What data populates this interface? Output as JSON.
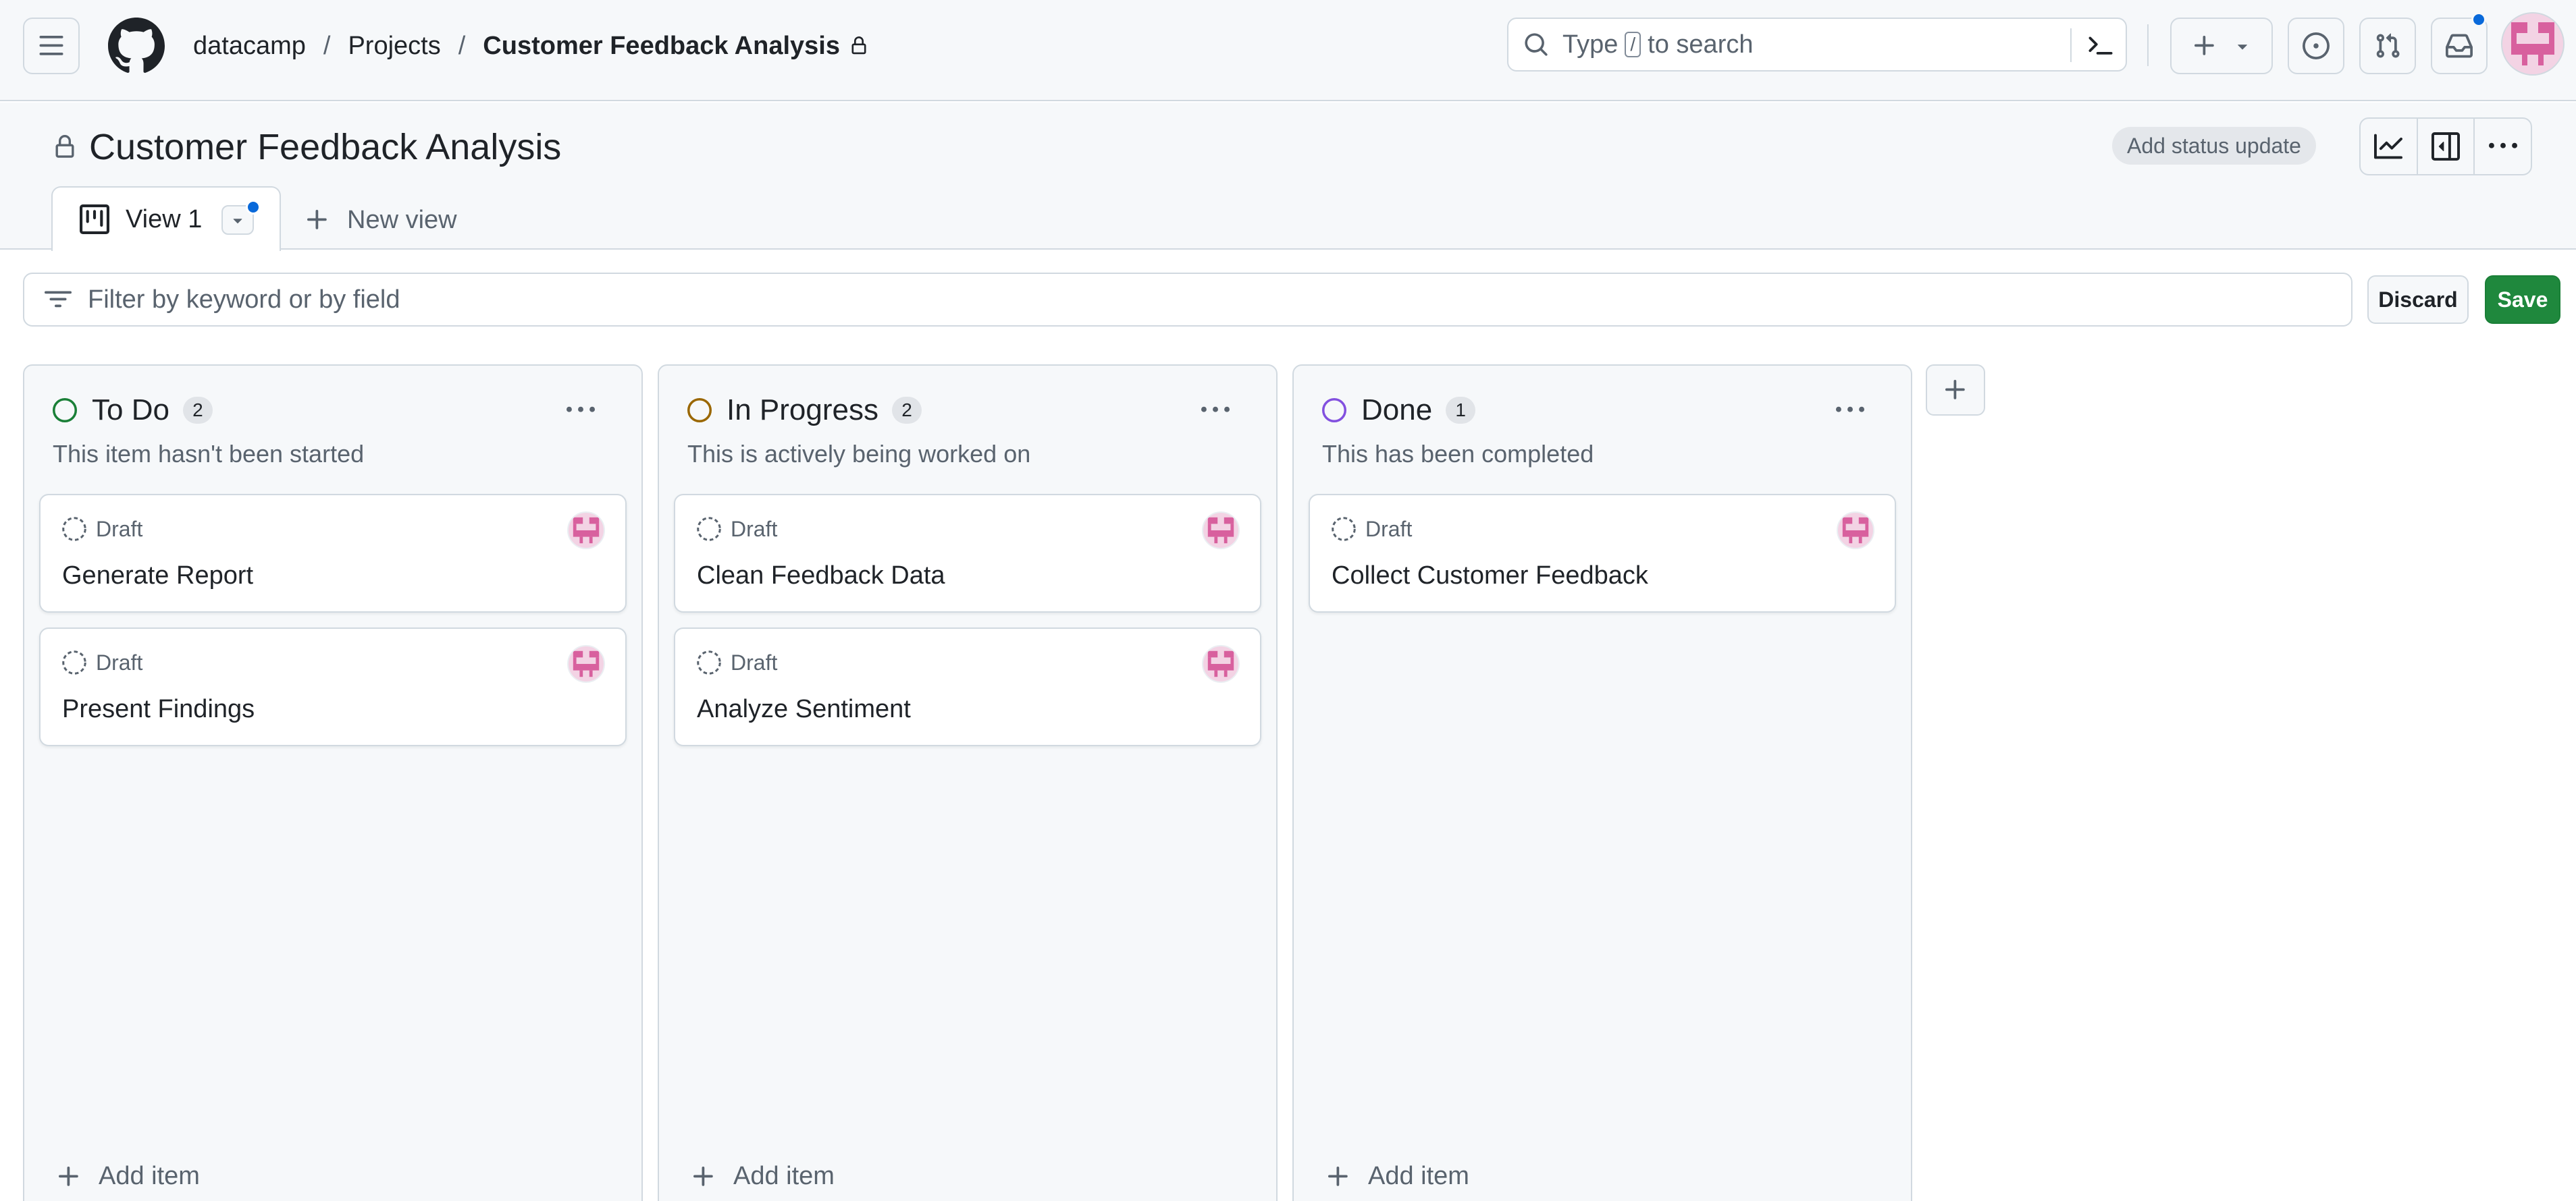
{
  "header": {
    "org": "datacamp",
    "separator": "/",
    "projects_label": "Projects",
    "project_name": "Customer Feedback Analysis",
    "search": {
      "prefix": "Type",
      "key": "/",
      "suffix": "to search"
    }
  },
  "project": {
    "title": "Customer Feedback Analysis",
    "status_button": "Add status update",
    "tabs": [
      {
        "label": "View 1",
        "active": true,
        "icon": "board-icon"
      }
    ],
    "new_view_label": "New view"
  },
  "filter": {
    "placeholder": "Filter by keyword or by field",
    "discard_label": "Discard",
    "save_label": "Save"
  },
  "board": {
    "add_item_label": "Add item",
    "columns": [
      {
        "title": "To Do",
        "count": "2",
        "description": "This item hasn't been started",
        "color": "#1a7f37",
        "cards": [
          {
            "status": "Draft",
            "title": "Generate Report"
          },
          {
            "status": "Draft",
            "title": "Present Findings"
          }
        ]
      },
      {
        "title": "In Progress",
        "count": "2",
        "description": "This is actively being worked on",
        "color": "#9a6700",
        "cards": [
          {
            "status": "Draft",
            "title": "Clean Feedback Data"
          },
          {
            "status": "Draft",
            "title": "Analyze Sentiment"
          }
        ]
      },
      {
        "title": "Done",
        "count": "1",
        "description": "This has been completed",
        "color": "#8250df",
        "cards": [
          {
            "status": "Draft",
            "title": "Collect Customer Feedback"
          }
        ]
      }
    ]
  },
  "colors": {
    "accent_blue": "#0969da",
    "save_green": "#1f883d",
    "avatar_pink": "#d8609e"
  }
}
